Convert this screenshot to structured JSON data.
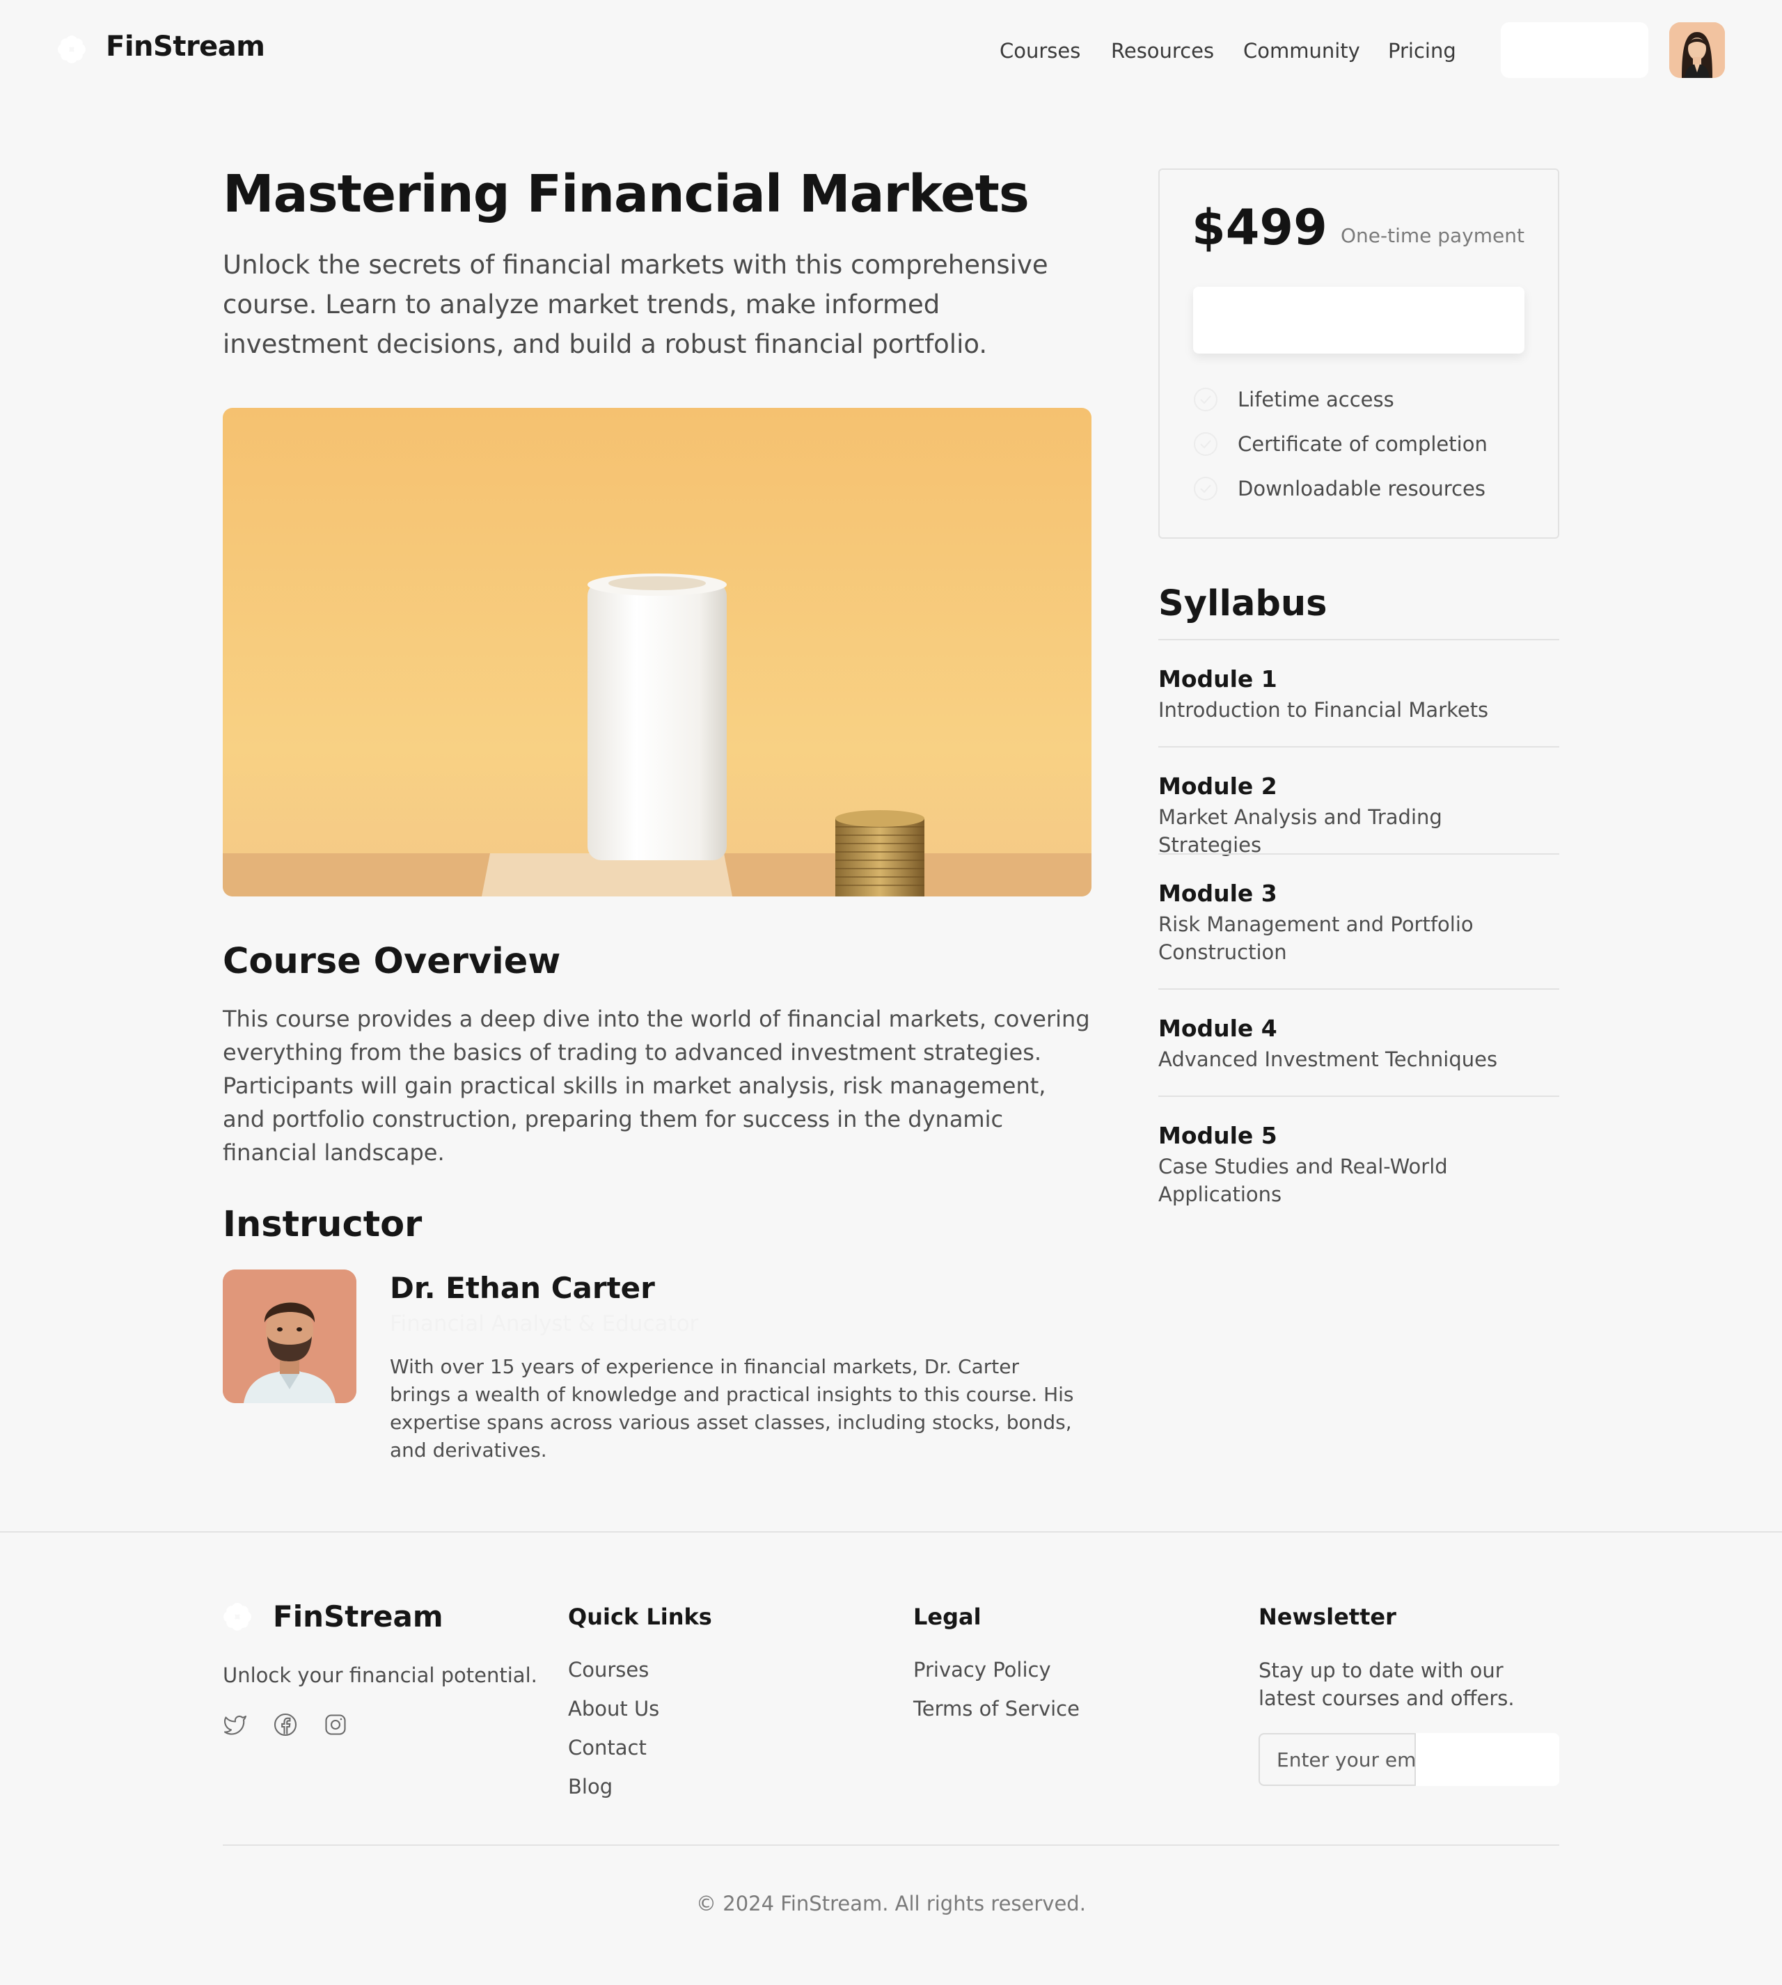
{
  "header": {
    "brand": "FinStream",
    "nav": [
      "Courses",
      "Resources",
      "Community",
      "Pricing"
    ],
    "avatar_icon": "user-avatar"
  },
  "course": {
    "title": "Mastering Financial Markets",
    "subtitle": "Unlock the secrets of financial markets with this comprehensive course. Learn to analyze market trends, make informed investment decisions, and build a robust financial portfolio.",
    "overview_heading": "Course Overview",
    "overview_text": "This course provides a deep dive into the world of financial markets, covering everything from the basics of trading to advanced investment strategies. Participants will gain practical skills in market analysis, risk management, and portfolio construction, preparing them for success in the dynamic financial landscape."
  },
  "instructor": {
    "heading": "Instructor",
    "name": "Dr. Ethan Carter",
    "role": "Financial Analyst & Educator",
    "bio": "With over 15 years of experience in financial markets, Dr. Carter brings a wealth of knowledge and practical insights to this course. His expertise spans across various asset classes, including stocks, bonds, and derivatives."
  },
  "pricing": {
    "price": "$499",
    "note": "One-time payment",
    "features": [
      "Lifetime access",
      "Certificate of completion",
      "Downloadable resources"
    ]
  },
  "syllabus": {
    "heading": "Syllabus",
    "modules": [
      {
        "name": "Module 1",
        "desc": "Introduction to Financial Markets"
      },
      {
        "name": "Module 2",
        "desc": "Market Analysis and Trading Strategies"
      },
      {
        "name": "Module 3",
        "desc": "Risk Management and Portfolio Construction"
      },
      {
        "name": "Module 4",
        "desc": "Advanced Investment Techniques"
      },
      {
        "name": "Module 5",
        "desc": "Case Studies and Real-World Applications"
      }
    ]
  },
  "footer": {
    "brand": "FinStream",
    "tagline": "Unlock your financial potential.",
    "social_icons": [
      "twitter-icon",
      "facebook-icon",
      "instagram-icon"
    ],
    "quick_links_heading": "Quick Links",
    "quick_links": [
      "Courses",
      "About Us",
      "Contact",
      "Blog"
    ],
    "legal_heading": "Legal",
    "legal_links": [
      "Privacy Policy",
      "Terms of Service"
    ],
    "newsletter_heading": "Newsletter",
    "newsletter_text": "Stay up to date with our latest courses and offers.",
    "newsletter_placeholder": "Enter your email",
    "copyright": "© 2024 FinStream. All rights reserved."
  },
  "colors": {
    "background": "#f7f7f7",
    "text": "#1a1a1a",
    "muted": "#4d4d4d",
    "hero": "#f3c67a"
  }
}
